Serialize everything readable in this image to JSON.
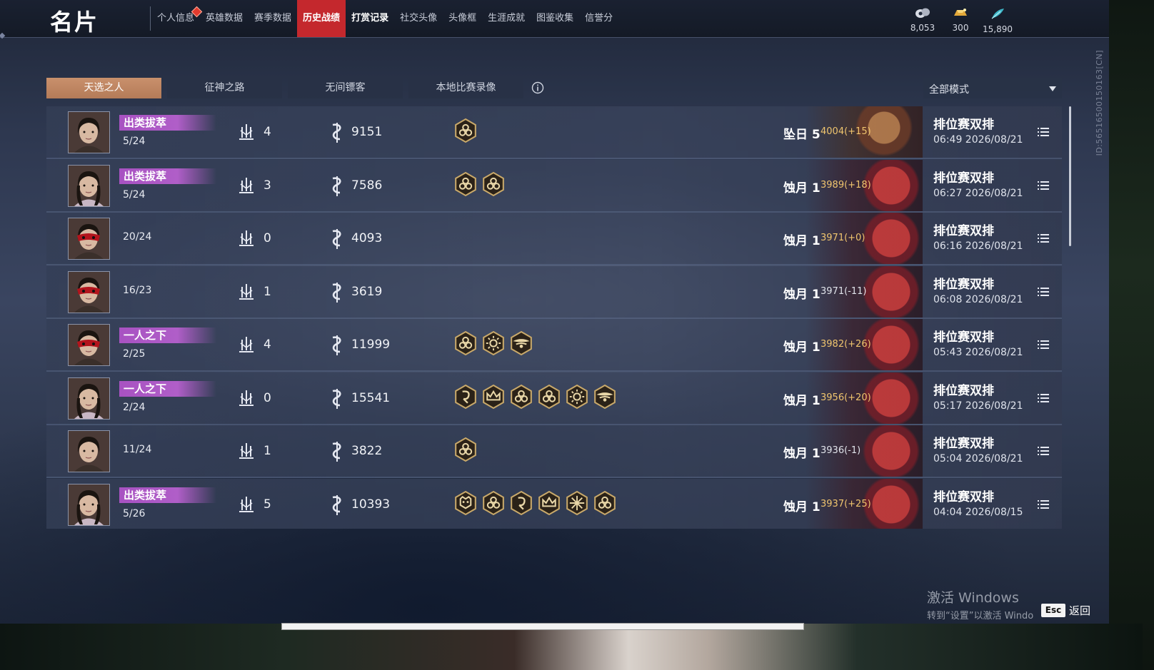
{
  "header": {
    "title": "名片",
    "nav": [
      {
        "label": "个人信息",
        "state": "notify"
      },
      {
        "label": "英雄数据",
        "state": "normal"
      },
      {
        "label": "赛季数据",
        "state": "normal"
      },
      {
        "label": "历史战绩",
        "state": "active"
      },
      {
        "label": "打赏记录",
        "state": "bold"
      },
      {
        "label": "社交头像",
        "state": "normal"
      },
      {
        "label": "头像框",
        "state": "normal"
      },
      {
        "label": "生涯成就",
        "state": "normal"
      },
      {
        "label": "图鉴收集",
        "state": "normal"
      },
      {
        "label": "信誉分",
        "state": "normal"
      }
    ],
    "currencies": [
      {
        "icon": "coin-pouch-icon",
        "value": "8,053"
      },
      {
        "icon": "gold-ingot-icon",
        "value": "300"
      },
      {
        "icon": "feather-icon",
        "value": "15,890"
      }
    ]
  },
  "side_id": "ID:5651650015016​3[CN]",
  "tabs": [
    "天选之人",
    "征神之路",
    "无间镖客",
    "本地比赛录像"
  ],
  "active_tab": 0,
  "mode_select": {
    "value": "全部模式"
  },
  "matches": [
    {
      "title": "出类拔萃",
      "place": "5/24",
      "kills": "4",
      "damage": "9151",
      "badges": [
        "triskele"
      ],
      "rank": "坠日 5",
      "score": "4004(+15)",
      "score_color": "gold",
      "mode": "排位赛双排",
      "time": "06:49  2026/08/21"
    },
    {
      "title": "出类拔萃",
      "place": "5/24",
      "kills": "3",
      "damage": "7586",
      "badges": [
        "triskele",
        "triskele"
      ],
      "rank": "蚀月 1",
      "score": "3989(+18)",
      "score_color": "gold",
      "mode": "排位赛双排",
      "time": "06:27  2026/08/21"
    },
    {
      "title": "",
      "place": "20/24",
      "kills": "0",
      "damage": "4093",
      "badges": [],
      "rank": "蚀月 1",
      "score": "3971(+0)",
      "score_color": "gold",
      "mode": "排位赛双排",
      "time": "06:16  2026/08/21"
    },
    {
      "title": "",
      "place": "16/23",
      "kills": "1",
      "damage": "3619",
      "badges": [],
      "rank": "蚀月 1",
      "score": "3971(-11)",
      "score_color": "neutral",
      "mode": "排位赛双排",
      "time": "06:08  2026/08/21"
    },
    {
      "title": "一人之下",
      "place": "2/25",
      "kills": "4",
      "damage": "11999",
      "badges": [
        "triskele",
        "sun",
        "wings"
      ],
      "rank": "蚀月 1",
      "score": "3982(+26)",
      "score_color": "gold",
      "mode": "排位赛双排",
      "time": "05:43  2026/08/21"
    },
    {
      "title": "一人之下",
      "place": "2/24",
      "kills": "0",
      "damage": "15541",
      "badges": [
        "swirl",
        "crown",
        "triskele",
        "triskele",
        "sun",
        "wings"
      ],
      "rank": "蚀月 1",
      "score": "3956(+20)",
      "score_color": "gold",
      "mode": "排位赛双排",
      "time": "05:17  2026/08/21"
    },
    {
      "title": "",
      "place": "11/24",
      "kills": "1",
      "damage": "3822",
      "badges": [
        "triskele"
      ],
      "rank": "蚀月 1",
      "score": "3936(-1)",
      "score_color": "neutral",
      "mode": "排位赛双排",
      "time": "05:04  2026/08/21"
    },
    {
      "title": "出类拔萃",
      "place": "5/26",
      "kills": "5",
      "damage": "10393",
      "badges": [
        "beast",
        "triskele",
        "swirl",
        "crown",
        "star",
        "triskele"
      ],
      "rank": "蚀月 1",
      "score": "3937(+25)",
      "score_color": "gold",
      "mode": "排位赛双排",
      "time": "04:04  2026/08/15"
    }
  ],
  "watermark": {
    "line1": "激活 Windows",
    "line2": "转到“设置”以激活 Windo"
  },
  "footer": {
    "esc_key": "Esc",
    "back_label": "返回"
  },
  "colors": {
    "active_nav": "#c4282d",
    "active_tab": "#b47b58",
    "title_badge": "#a852c2",
    "score_gold": "#f0c56e"
  }
}
